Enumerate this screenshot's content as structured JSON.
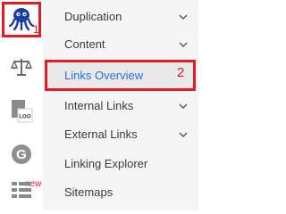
{
  "rail": {
    "icons": [
      {
        "name": "octopus-logo-icon",
        "color": "#1a3d9e"
      },
      {
        "name": "scale-icon"
      },
      {
        "name": "loo-document-icon",
        "label": "LOO"
      },
      {
        "name": "google-icon"
      },
      {
        "name": "grid-list-icon"
      }
    ],
    "new_badge": "new",
    "marker_1": "1"
  },
  "menu": {
    "items": [
      {
        "label": "Duplication",
        "has_chevron": true
      },
      {
        "label": "Content",
        "has_chevron": true
      },
      {
        "label": "Links Overview",
        "has_chevron": false,
        "active": true
      },
      {
        "label": "Internal Links",
        "has_chevron": true
      },
      {
        "label": "External Links",
        "has_chevron": true
      },
      {
        "label": "Linking Explorer",
        "has_chevron": false
      },
      {
        "label": "Sitemaps",
        "has_chevron": false
      }
    ],
    "marker_2": "2"
  },
  "colors": {
    "accent_red": "#e31b23",
    "active_text": "#2d6cdf",
    "text": "#3a3a3a"
  }
}
